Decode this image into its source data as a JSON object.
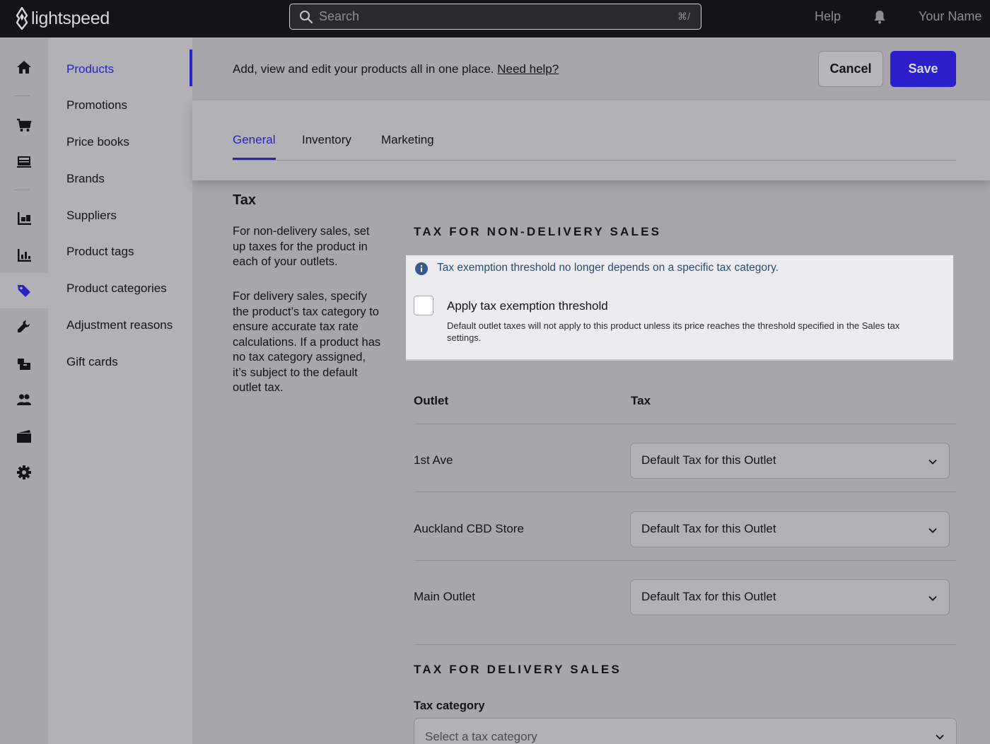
{
  "topbar": {
    "logo_text": "lightspeed",
    "search_placeholder": "Search",
    "search_shortcut": "⌘/",
    "help": "Help",
    "user_name": "Your Name"
  },
  "rail": {
    "icons": [
      "home-icon",
      "cart-icon",
      "register-icon",
      "inventory-icon",
      "reports-icon",
      "products-tag-icon",
      "tools-icon",
      "packages-icon",
      "customers-icon",
      "ecommerce-icon",
      "settings-icon"
    ],
    "active": "products-tag-icon"
  },
  "subnav": {
    "items": [
      {
        "label": "Products",
        "active": true
      },
      {
        "label": "Promotions"
      },
      {
        "label": "Price books"
      },
      {
        "label": "Brands"
      },
      {
        "label": "Suppliers"
      },
      {
        "label": "Product tags"
      },
      {
        "label": "Product categories"
      },
      {
        "label": "Adjustment reasons"
      },
      {
        "label": "Gift cards"
      }
    ]
  },
  "header": {
    "description": "Add, view and edit your products all in one place.",
    "help_link": "Need help?",
    "cancel": "Cancel",
    "save": "Save"
  },
  "tabs": [
    {
      "label": "General",
      "active": true
    },
    {
      "label": "Inventory"
    },
    {
      "label": "Marketing"
    }
  ],
  "tax": {
    "title": "Tax",
    "desc_non_delivery": "For non-delivery sales, set up taxes for the product in each of your outlets.",
    "desc_delivery": "For delivery sales, specify the product’s tax category to ensure accurate tax rate calculations. If a product has no tax category assigned, it’s subject to the default outlet tax.",
    "non_delivery_heading": "TAX FOR NON-DELIVERY SALES",
    "info_message": "Tax exemption threshold no longer depends on a specific tax category.",
    "threshold_label": "Apply tax exemption threshold",
    "threshold_checked": false,
    "threshold_help": "Default outlet taxes will not apply to this product unless its price reaches the threshold specified in the Sales tax settings.",
    "col_outlet": "Outlet",
    "col_tax": "Tax",
    "outlets": [
      {
        "name": "1st Ave",
        "tax": "Default Tax for this Outlet"
      },
      {
        "name": "Auckland CBD Store",
        "tax": "Default Tax for this Outlet"
      },
      {
        "name": "Main Outlet",
        "tax": "Default Tax for this Outlet"
      }
    ],
    "delivery_heading": "TAX FOR DELIVERY SALES",
    "tax_category_label": "Tax category",
    "tax_category_placeholder": "Select a tax category"
  },
  "colors": {
    "accent": "#2a22c0",
    "save_button": "#2a1fc9",
    "topbar": "#141418",
    "info_text": "#2b4a6e"
  }
}
